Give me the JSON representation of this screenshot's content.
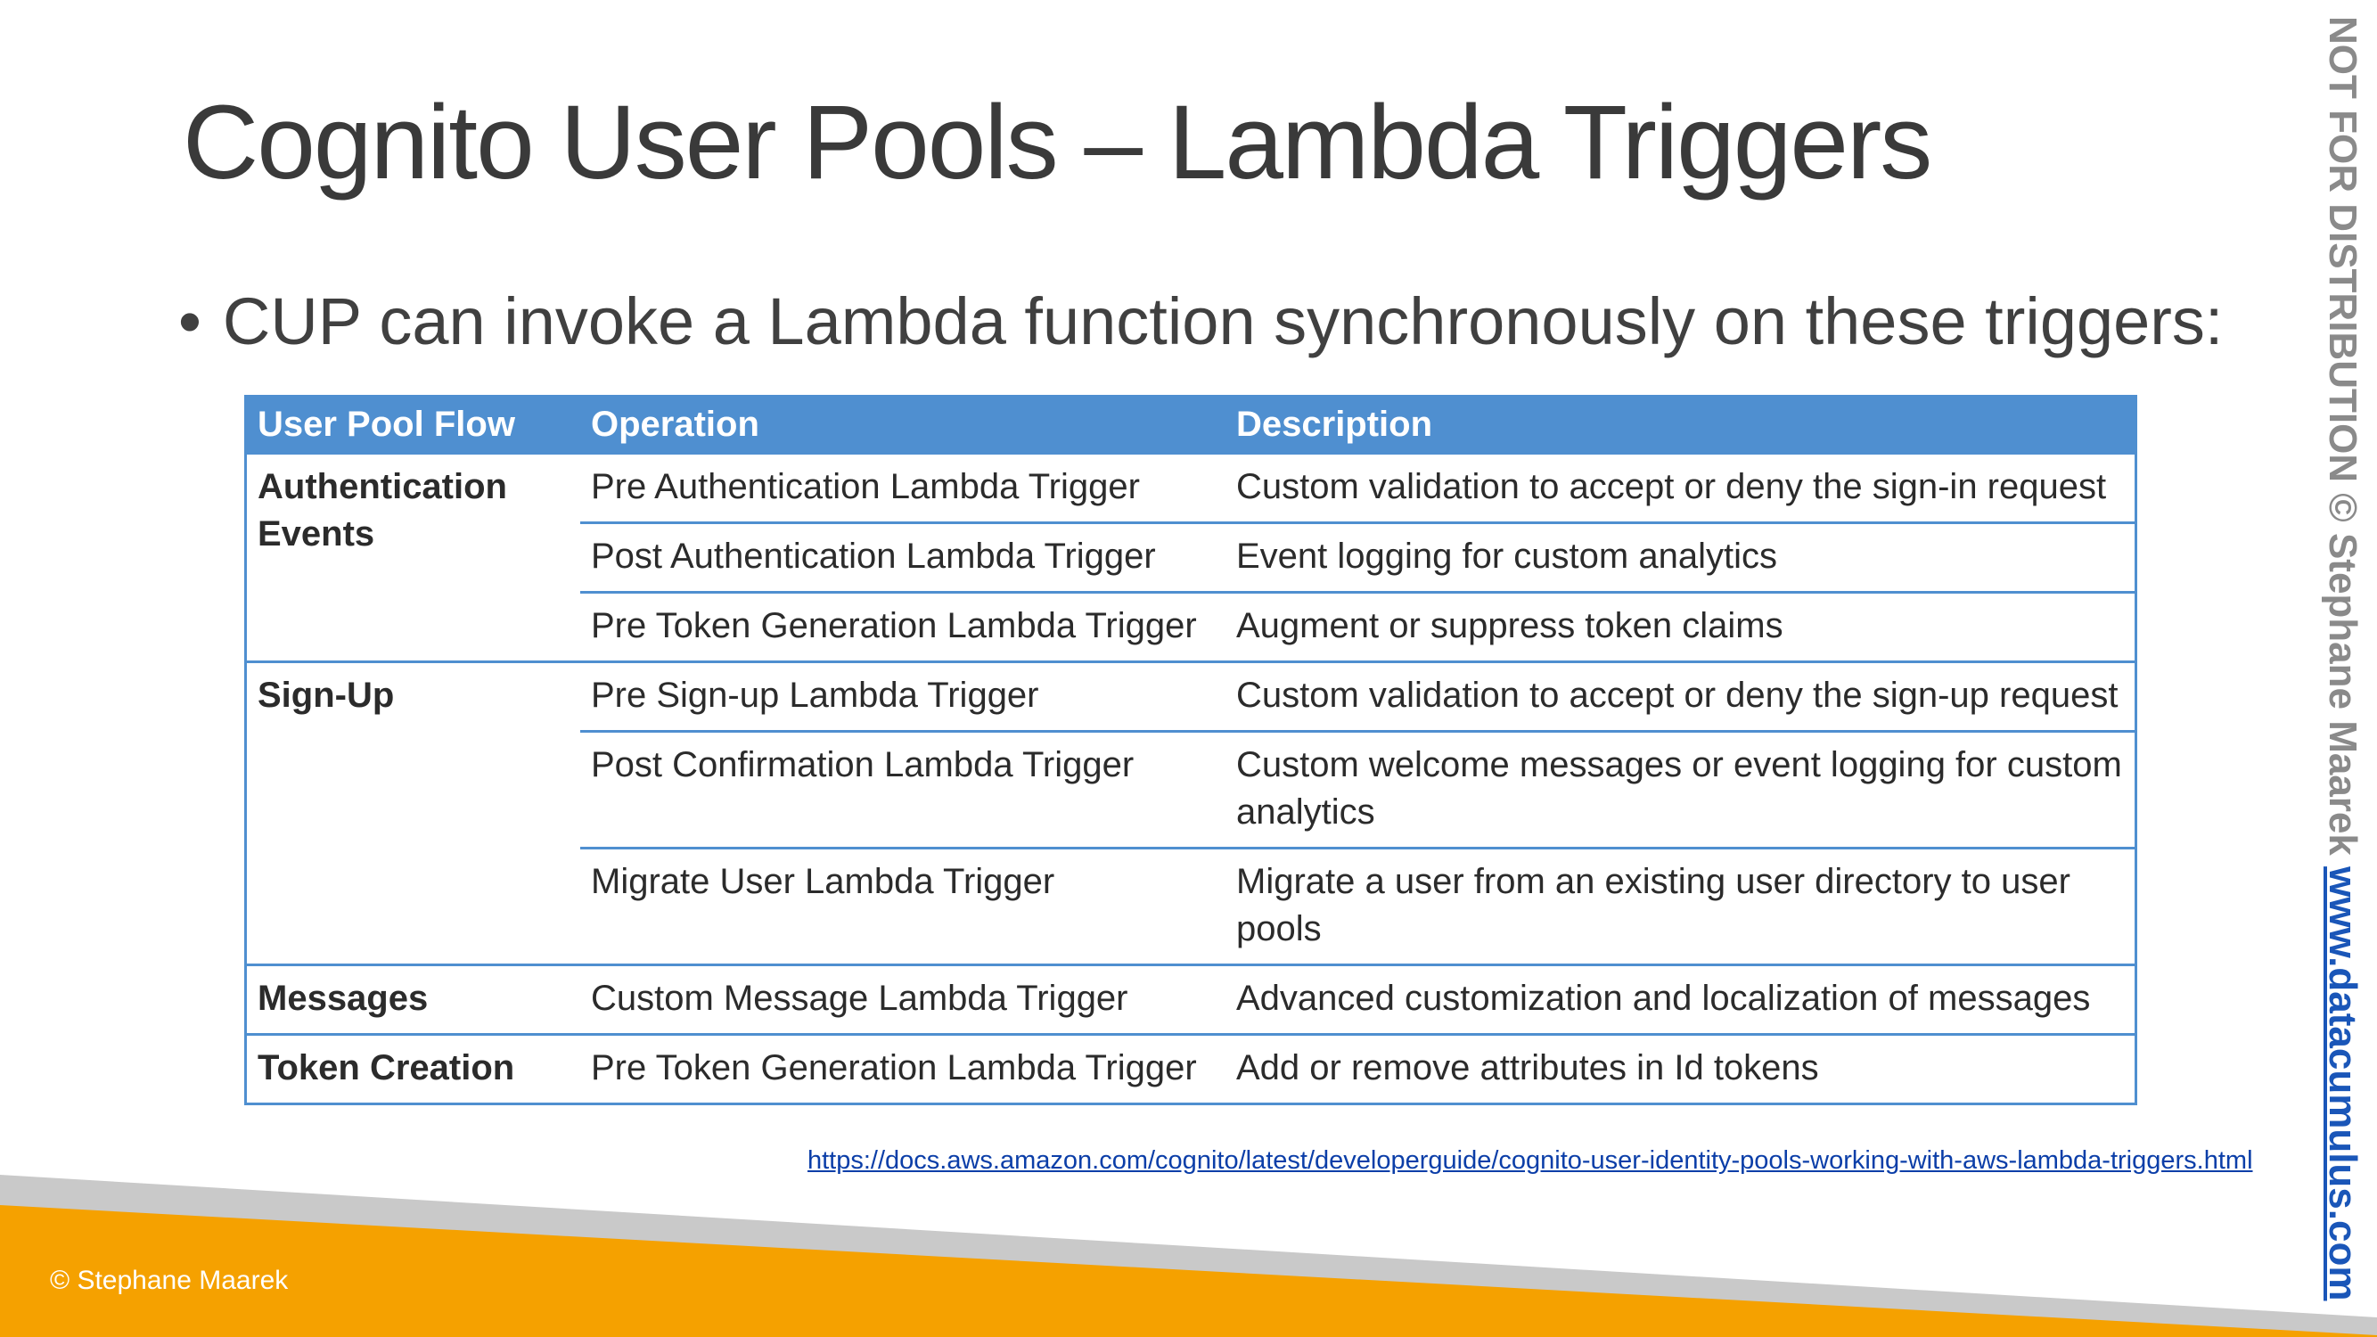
{
  "title": "Cognito User Pools – Lambda Triggers",
  "bullet": {
    "symbol": "•",
    "text": "CUP can invoke a Lambda function synchronously on these triggers:"
  },
  "table": {
    "headers": [
      "User Pool Flow",
      "Operation",
      "Description"
    ],
    "groups": [
      {
        "flow": "Authentication Events",
        "rows": [
          {
            "operation": "Pre Authentication Lambda Trigger",
            "description": "Custom validation to accept or deny the sign-in request"
          },
          {
            "operation": "Post Authentication Lambda Trigger",
            "description": "Event logging for custom analytics"
          },
          {
            "operation": "Pre Token Generation Lambda Trigger",
            "description": "Augment or suppress token claims"
          }
        ]
      },
      {
        "flow": "Sign-Up",
        "rows": [
          {
            "operation": "Pre Sign-up Lambda Trigger",
            "description": "Custom validation to accept or deny the sign-up request"
          },
          {
            "operation": "Post Confirmation Lambda Trigger",
            "description": "Custom welcome messages or event logging for custom analytics"
          },
          {
            "operation": "Migrate User Lambda Trigger",
            "description": "Migrate a user from an existing user directory to user pools"
          }
        ]
      },
      {
        "flow": "Messages",
        "rows": [
          {
            "operation": "Custom Message Lambda Trigger",
            "description": "Advanced customization and localization of messages"
          }
        ]
      },
      {
        "flow": "Token Creation",
        "rows": [
          {
            "operation": "Pre Token Generation Lambda Trigger",
            "description": "Add or remove attributes in Id tokens"
          }
        ]
      }
    ]
  },
  "link": "https://docs.aws.amazon.com/cognito/latest/developerguide/cognito-user-identity-pools-working-with-aws-lambda-triggers.html",
  "watermark": {
    "text": "NOT FOR DISTRIBUTION © Stephane Maarek ",
    "url": "www.datacumulus.com"
  },
  "footer": {
    "copyright": "© Stephane Maarek"
  },
  "colors": {
    "table_accent": "#4f8fd0",
    "footer_orange": "#f5a100",
    "footer_gray": "#c9c9c9",
    "link_blue": "#0b3ea8"
  }
}
